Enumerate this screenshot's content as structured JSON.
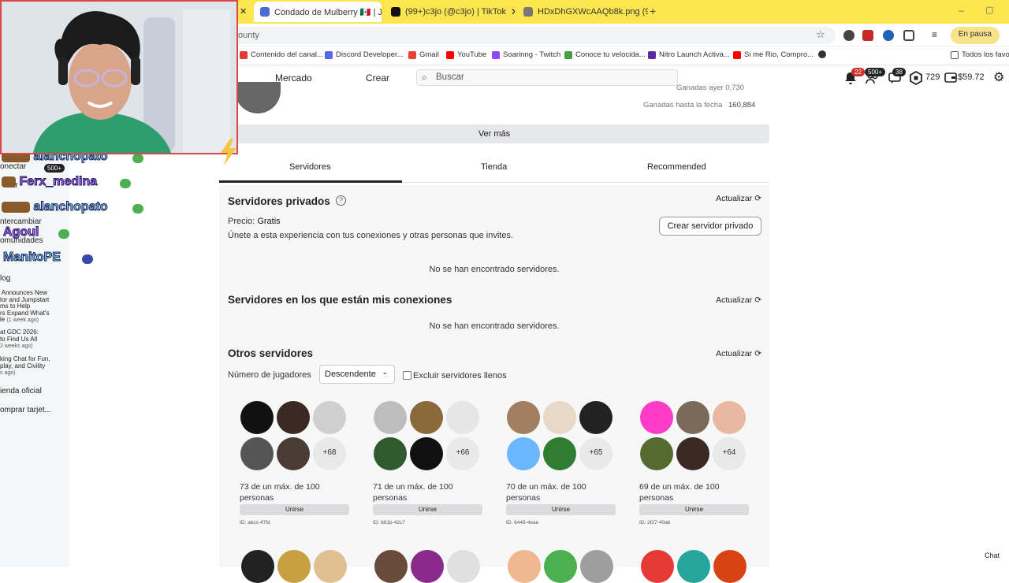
{
  "browser": {
    "tabs": [
      {
        "title": "Condado de Mulberry 🇲🇽 | Jue",
        "color": "#4a6cd4",
        "active": true
      },
      {
        "title": "(99+)c3jo (@c3jo) | TikTok",
        "color": "#111111",
        "active": false
      },
      {
        "title": "HDxDhGXWcAAQb8k.png (960",
        "color": "#555555",
        "active": false
      }
    ],
    "new_tab": "+",
    "url": "ounty",
    "paused_label": "En pausa",
    "bookmarks": [
      {
        "label": "Contenido del canal...",
        "color": "#e53935"
      },
      {
        "label": "Discord Developer...",
        "color": "#5865f2"
      },
      {
        "label": "Gmail",
        "color": "#ea4335"
      },
      {
        "label": "YouTube",
        "color": "#ff0000"
      },
      {
        "label": "Soarinng - Twitch",
        "color": "#9146ff"
      },
      {
        "label": "Conoce tu velocida...",
        "color": "#43a047"
      },
      {
        "label": "Nitro Launch Activa...",
        "color": "#5b2aa0"
      },
      {
        "label": "Si me Rio, Compro...",
        "color": "#ff0000"
      }
    ],
    "all_bookmarks": "Todos los favor"
  },
  "nav": {
    "market": "Mercado",
    "create": "Crear",
    "search_placeholder": "Buscar",
    "notif_count": "22",
    "friends_count": "500+",
    "messages_count": "38",
    "robux": "729",
    "balance": "$59.72"
  },
  "sidebar": {
    "connect": "onectar",
    "connect_badge": "500+",
    "trade": "ntercambiar",
    "communities": "omunidades",
    "blog": "log",
    "blog_posts": [
      {
        "text": " Announces New\ntor and Jumpstart\nms to Help\nrs Expand What's\nle",
        "age": "(1 week ago)"
      },
      {
        "text": "at GDC 2026:\nto Find Us All",
        "age": "2 weeks ago)"
      },
      {
        "text": "king Chat for Fun,\nplay, and Civility",
        "age": "s ago)"
      }
    ],
    "official_store": "ienda oficial",
    "buy_cards": "omprar tarjet...",
    "chat_names": [
      {
        "name": "alanchopato",
        "color": "#7ee0c8"
      },
      {
        "name": "Ferx_medina",
        "color": "#c36be0"
      },
      {
        "name": "alanchopato",
        "color": "#7ee0c8"
      },
      {
        "name": "Agoul",
        "color": "#c36be0"
      },
      {
        "name": "ManitoPE",
        "color": "#7ee0c8"
      }
    ],
    "short_label": "ar"
  },
  "stats": {
    "partial": "Ganadas ayer   0,730",
    "earned_label": "Ganadas hasta la fecha",
    "earned_value": "160,884"
  },
  "see_more": "Ver más",
  "tabs": [
    "Servidores",
    "Tienda",
    "Recommended"
  ],
  "private": {
    "title": "Servidores privados",
    "refresh": "Actualizar",
    "price_label": "Precio:",
    "price_value": "Gratis",
    "description": "Únete a esta experiencia con tus conexiones y otras personas que invites.",
    "create_button": "Crear servidor privado",
    "empty": "No se han encontrado servidores."
  },
  "friends_servers": {
    "title": "Servidores en los que están mis conexiones",
    "refresh": "Actualizar",
    "empty": "No se han encontrado servidores."
  },
  "other_servers": {
    "title": "Otros servidores",
    "refresh": "Actualizar",
    "players_label": "Número de jugadores",
    "sort": "Descendente",
    "exclude_full": "Excluir servidores llenos",
    "servers": [
      {
        "more": "+68",
        "players": "73 de un máx. de 100 personas",
        "join": "Unirse",
        "id": "ID: abcc-47fd",
        "avatars": [
          "#111111",
          "#3b2a22",
          "#cfcfcf",
          "#555555",
          "#4a3b33"
        ]
      },
      {
        "more": "+66",
        "players": "71 de un máx. de 100 personas",
        "join": "Unirse",
        "id": "ID: 681b-42c7",
        "avatars": [
          "#bdbdbd",
          "#8a6a3a",
          "#e6e6e6",
          "#2e5a2e",
          "#111111"
        ]
      },
      {
        "more": "+65",
        "players": "70 de un máx. de 100 personas",
        "join": "Unirse",
        "id": "ID: 6448-4eae",
        "avatars": [
          "#a08060",
          "#e8d8c8",
          "#222222",
          "#6ab7ff",
          "#2e7d32"
        ]
      },
      {
        "more": "+64",
        "players": "69 de un máx. de 100 personas",
        "join": "Unirse",
        "id": "ID: 2f27-40ab",
        "avatars": [
          "#ff3cc8",
          "#7a6a5a",
          "#e8b8a0",
          "#556b2f",
          "#3a2a22"
        ]
      }
    ]
  },
  "chat_label": "Chat"
}
